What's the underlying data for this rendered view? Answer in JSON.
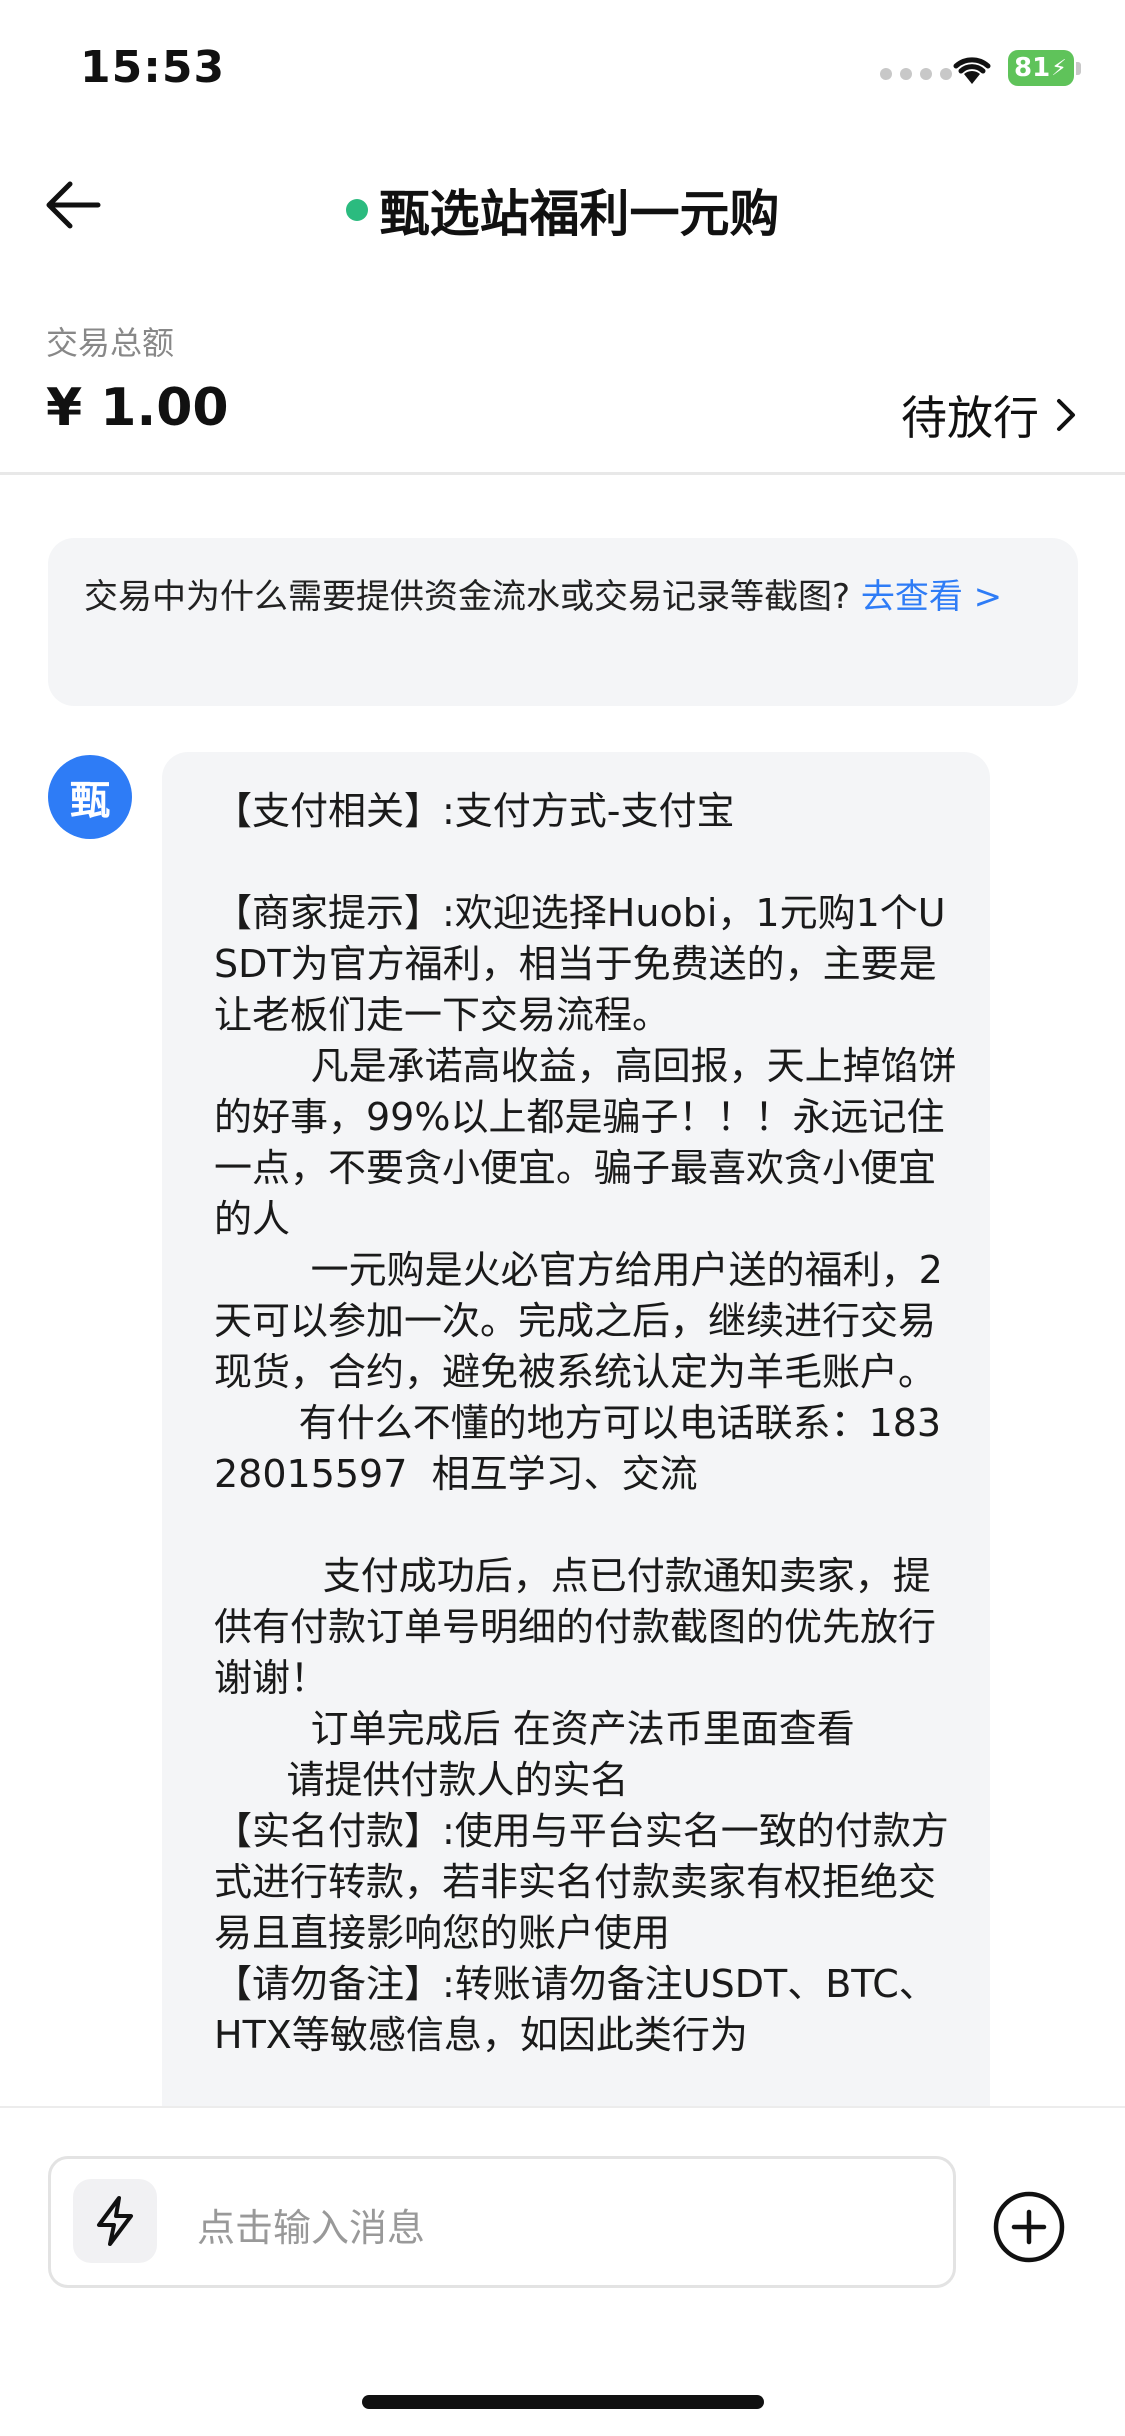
{
  "status_bar": {
    "time": "15:53",
    "battery": "81"
  },
  "nav": {
    "title": "甄选站福利一元购"
  },
  "trade": {
    "amount_label": "交易总额",
    "amount": "¥ 1.00",
    "status": "待放行"
  },
  "notice": {
    "text": "交易中为什么需要提供资金流水或交易记录等截图? ",
    "link": "去查看 >"
  },
  "message": {
    "avatar_char": "甄",
    "text": "【支付相关】:支付方式-支付宝\n\n【商家提示】:欢迎选择Huobi，1元购1个USDT为官方福利，相当于免费送的，主要是让老板们走一下交易流程。\n        凡是承诺高收益，高回报，天上掉馅饼的好事，99%以上都是骗子！！！永远记住一点，不要贪小便宜。骗子最喜欢贪小便宜的人\n        一元购是火必官方给用户送的福利，2天可以参加一次。完成之后，继续进行交易现货，合约，避免被系统认定为羊毛账户。\n       有什么不懂的地方可以电话联系：18328015597  相互学习、交流\n\n         支付成功后，点已付款通知卖家，提供有付款订单号明细的付款截图的优先放行谢谢！\n        订单完成后 在资产法币里面查看\n      请提供付款人的实名\n【实名付款】:使用与平台实名一致的付款方式进行转款，若非实名付款卖家有权拒绝交易且直接影响您的账户使用\n【请勿备注】:转账请勿备注USDT、BTC、HTX等敏感信息，如因此类行为"
  },
  "input": {
    "placeholder": "点击输入消息"
  },
  "colors": {
    "accent": "#2e7cf6",
    "online": "#2bbb7f",
    "battery": "#5fc35a"
  },
  "icons": [
    "back-arrow-icon",
    "wifi-icon",
    "chevron-right-icon",
    "lightning-icon",
    "plus-circle-icon"
  ]
}
